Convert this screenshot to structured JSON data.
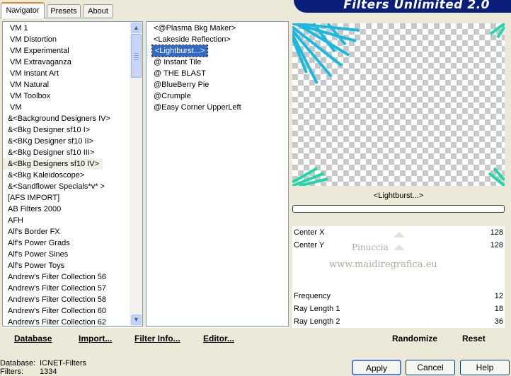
{
  "tabs": [
    {
      "label": "Navigator",
      "active": true
    },
    {
      "label": "Presets",
      "active": false
    },
    {
      "label": "About",
      "active": false
    }
  ],
  "banner_title": "Filters Unlimited 2.0",
  "categories": [
    "VM 1",
    "VM Distortion",
    "VM Experimental",
    "VM Extravaganza",
    "VM Instant Art",
    "VM Natural",
    "VM Toolbox",
    "VM",
    "&<Background Designers IV>",
    "&<Bkg Designer sf10 I>",
    "&<BKg Designer sf10 II>",
    "&<Bkg Designer sf10 III>",
    "&<Bkg Designers sf10 IV>",
    "&<Bkg Kaleidoscope>",
    "&<Sandflower Specials*v* >",
    "[AFS IMPORT]",
    "AB Filters 2000",
    "AFH",
    "Alf's Border FX",
    "Alf's Power Grads",
    "Alf's Power Sines",
    "Alf's Power Toys",
    "Andrew's Filter Collection 56",
    "Andrew's Filter Collection 57",
    "Andrew's Filter Collection 58",
    "Andrew's Filter Collection 60",
    "Andrew's Filter Collection 62"
  ],
  "filters": [
    "<@Plasma Bkg Maker>",
    "<Lakeside Reflection>",
    "<Lightburst...>",
    "@ Instant Tile",
    "@ THE BLAST",
    "@BlueBerry Pie",
    "@Crumple",
    "@Easy Corner UpperLeft"
  ],
  "preview_filter_name": "<Lightburst...>",
  "params": [
    {
      "label": "Center X",
      "value": "128"
    },
    {
      "label": "Center Y",
      "value": "128"
    },
    {
      "label": "",
      "value": ""
    },
    {
      "label": "",
      "value": ""
    },
    {
      "label": "",
      "value": ""
    },
    {
      "label": "Frequency",
      "value": "12"
    },
    {
      "label": "Ray Length 1",
      "value": "18"
    },
    {
      "label": "Ray Length 2",
      "value": "36"
    }
  ],
  "watermark": {
    "line1": "Pinuccia",
    "line2": "www.maidiregrafica.eu"
  },
  "left_buttons": {
    "database": "Database",
    "import": "Import...",
    "filter_info": "Filter Info...",
    "editor": "Editor..."
  },
  "right_buttons": {
    "randomize": "Randomize",
    "reset": "Reset"
  },
  "status": {
    "database_label": "Database:",
    "database_value": "ICNET-Filters",
    "filters_label": "Filters:",
    "filters_value": "1334"
  },
  "dialog_buttons": {
    "apply": "Apply",
    "cancel": "Cancel",
    "help": "Help"
  },
  "colors": {
    "selection": "#316AC5",
    "banner": "#0A1F7A",
    "ray": "#1BB8E0",
    "ray_alt": "#23D6A8"
  }
}
